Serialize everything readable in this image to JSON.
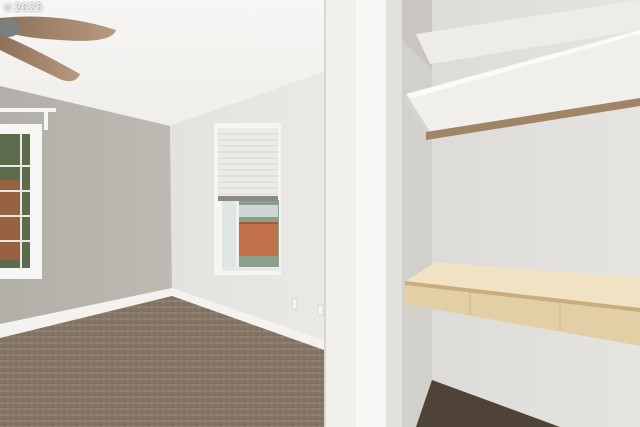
{
  "photo": {
    "watermark_symbol": "©",
    "watermark_year": "2025",
    "subject": "empty-bedroom-with-open-closet",
    "colors": {
      "ceiling": "#f4f3f0",
      "wall_left": "#b8b4ae",
      "wall_back": "#e7e5e1",
      "closet_wall": "#e2e0dc",
      "carpet": "#8a7a6a",
      "shelf_wood": "#e9d9b4",
      "fan_blade": "#a0826a",
      "fence": "#c2704a"
    }
  }
}
